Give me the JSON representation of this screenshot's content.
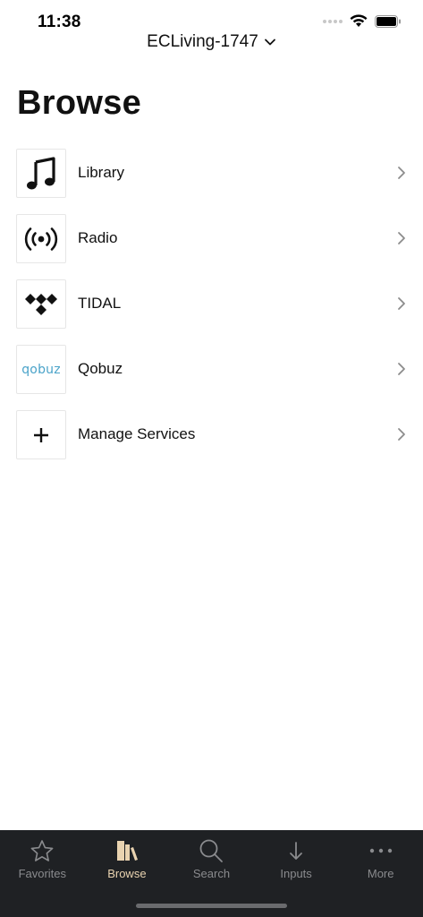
{
  "status": {
    "time": "11:38"
  },
  "header": {
    "device_name": "ECLiving-1747"
  },
  "page": {
    "title": "Browse"
  },
  "rows": [
    {
      "label": "Library",
      "icon": "music-note-icon"
    },
    {
      "label": "Radio",
      "icon": "radio-broadcast-icon"
    },
    {
      "label": "TIDAL",
      "icon": "tidal-logo-icon"
    },
    {
      "label": "Qobuz",
      "icon": "qobuz-logo",
      "logo_text": "qobuz"
    },
    {
      "label": "Manage Services",
      "icon": "plus-icon"
    }
  ],
  "tabs": [
    {
      "label": "Favorites",
      "icon": "star-icon",
      "active": false
    },
    {
      "label": "Browse",
      "icon": "browse-books-icon",
      "active": true
    },
    {
      "label": "Search",
      "icon": "search-icon",
      "active": false
    },
    {
      "label": "Inputs",
      "icon": "arrow-down-icon",
      "active": false
    },
    {
      "label": "More",
      "icon": "more-dots-icon",
      "active": false
    }
  ],
  "colors": {
    "tab_bar_bg": "#1f2124",
    "tab_active": "#e9d3b0",
    "tab_inactive": "#8a8b8e",
    "qobuz_blue": "#4aa3c9"
  }
}
